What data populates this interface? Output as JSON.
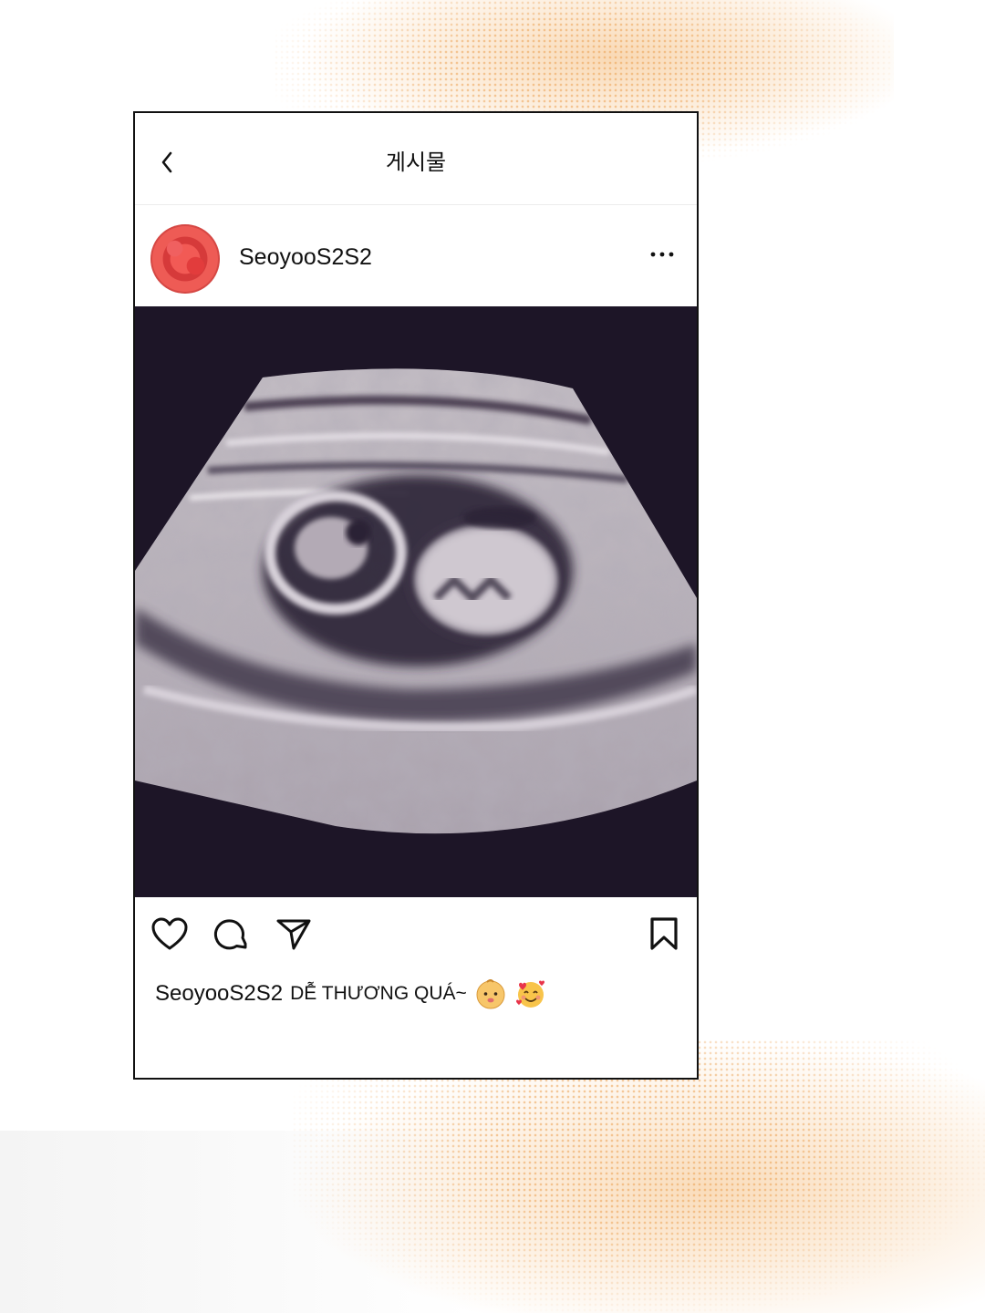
{
  "header": {
    "title": "게시물",
    "back_icon": "chevron-left-icon"
  },
  "post": {
    "username": "SeoyooS2S2",
    "more_icon": "more-horizontal-icon",
    "image_subject": "ultrasound scan"
  },
  "actions": {
    "icons": [
      "heart-icon",
      "comment-icon",
      "share-icon",
      "bookmark-icon"
    ]
  },
  "caption": {
    "username": "SeoyooS2S2",
    "text": "DỄ THƯƠNG QUÁ~",
    "emojis": [
      "baby-emoji",
      "smiling-face-with-hearts-emoji"
    ]
  }
}
